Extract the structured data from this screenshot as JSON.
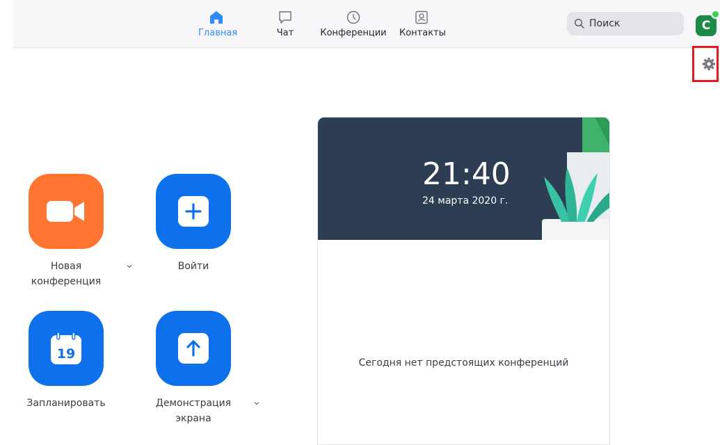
{
  "nav": {
    "tabs": [
      {
        "label": "Главная",
        "icon": "home-icon",
        "active": true
      },
      {
        "label": "Чат",
        "icon": "chat-icon",
        "active": false
      },
      {
        "label": "Конференции",
        "icon": "clock-icon",
        "active": false
      },
      {
        "label": "Контакты",
        "icon": "contacts-icon",
        "active": false
      }
    ]
  },
  "search": {
    "placeholder": "Поиск"
  },
  "user": {
    "avatar_initial": "С"
  },
  "actions": {
    "new_meeting": {
      "label_line1": "Новая",
      "label_line2": "конференция",
      "icon": "video-camera-icon"
    },
    "join": {
      "label": "Войти",
      "icon": "plus-icon"
    },
    "schedule": {
      "label": "Запланировать",
      "calendar_day": "19",
      "icon": "calendar-icon"
    },
    "share_screen": {
      "label_line1": "Демонстрация",
      "label_line2": "экрана",
      "icon": "share-arrow-icon"
    }
  },
  "schedule_card": {
    "time": "21:40",
    "date": "24 марта 2020 г.",
    "empty_message": "Сегодня нет предстоящих конференций"
  },
  "colors": {
    "accent": "#2d8cff",
    "orange_tile": "#ff742e",
    "blue_tile": "#0e71eb",
    "card_header": "#2c3d54",
    "highlight_border": "#e01b1b"
  }
}
